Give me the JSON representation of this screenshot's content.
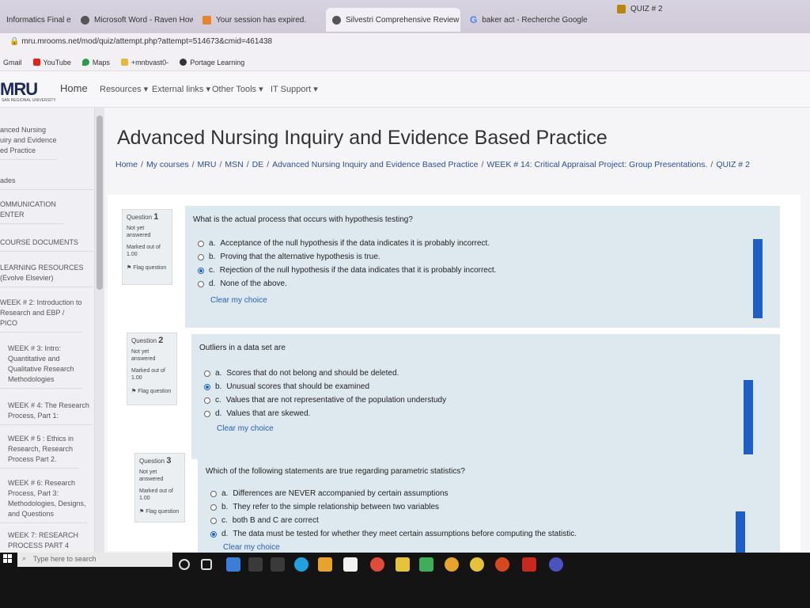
{
  "browser": {
    "tabs": [
      {
        "label": "Informatics Final en",
        "active": false
      },
      {
        "label": "Microsoft Word - Raven Howard",
        "active": false
      },
      {
        "label": "Your session has expired.",
        "active": false
      },
      {
        "label": "Silvestri Comprehensive Review",
        "active": true
      },
      {
        "label": "baker act - Recherche Google",
        "active": false
      },
      {
        "label": "QUIZ # 2",
        "active": false
      }
    ],
    "url": "mru.mrooms.net/mod/quiz/attempt.php?attempt=514673&cmid=461438",
    "bookmarks": [
      "Gmail",
      "YouTube",
      "Maps",
      "+mnbvast0-",
      "Portage Learning"
    ]
  },
  "site_nav": {
    "logo": "MRU",
    "logo_sub": "SAN REGIONAL UNIVERSITY",
    "home": "Home",
    "resources": "Resources ▾",
    "external_links": "External links ▾",
    "other_tools": "Other Tools ▾",
    "it_support": "IT Support ▾"
  },
  "drawer": {
    "course_name": "anced Nursing uiry and Evidence ed Practice",
    "items": [
      {
        "label": "ades"
      },
      {
        "label": "OMMUNICATION ENTER"
      },
      {
        "label": "COURSE DOCUMENTS"
      },
      {
        "label": "LEARNING RESOURCES (Evolve Elsevier)"
      },
      {
        "label": "WEEK # 2: Introduction to Research and EBP / PICO"
      },
      {
        "label": "WEEK # 3: Intro: Quantitative and Qualitative Research Methodologies"
      },
      {
        "label": "WEEK # 4: The Research Process, Part 1:"
      },
      {
        "label": "WEEK # 5 : Ethics in Research, Research Process Part 2."
      },
      {
        "label": "WEEK # 6: Research Process, Part 3: Methodologies, Designs, and Questions"
      },
      {
        "label": "WEEK 7: RESEARCH PROCESS PART 4"
      }
    ]
  },
  "page": {
    "title": "Advanced Nursing Inquiry and Evidence Based Practice",
    "breadcrumb": [
      "Home",
      "My courses",
      "MRU",
      "MSN",
      "DE",
      "Advanced Nursing Inquiry and Evidence Based Practice",
      "WEEK # 14: Critical Appraisal Project: Group Presentations.",
      "QUIZ # 2"
    ]
  },
  "questions": [
    {
      "label": "Question",
      "number": "1",
      "status": "Not yet answered",
      "marked": "Marked out of 1.00",
      "flag": "Flag question",
      "text": "What is the actual process that occurs with hypothesis testing?",
      "options": [
        {
          "letter": "a.",
          "text": "Acceptance of the null hypothesis if the data indicates it is probably incorrect.",
          "selected": false
        },
        {
          "letter": "b.",
          "text": "Proving that the alternative hypothesis is true.",
          "selected": false
        },
        {
          "letter": "c.",
          "text": "Rejection of the null hypothesis if the data indicates that it is probably incorrect.",
          "selected": true
        },
        {
          "letter": "d.",
          "text": "None of the above.",
          "selected": false
        }
      ],
      "clear": "Clear my choice"
    },
    {
      "label": "Question",
      "number": "2",
      "status": "Not yet answered",
      "marked": "Marked out of 1.00",
      "flag": "Flag question",
      "text": "Outliers in a data set are",
      "options": [
        {
          "letter": "a.",
          "text": "Scores that do not belong and should be deleted.",
          "selected": false
        },
        {
          "letter": "b.",
          "text": "Unusual scores that should be examined",
          "selected": true
        },
        {
          "letter": "c.",
          "text": "Values that are not representative of the population understudy",
          "selected": false
        },
        {
          "letter": "d.",
          "text": "Values that are skewed.",
          "selected": false
        }
      ],
      "clear": "Clear my choice"
    },
    {
      "label": "Question",
      "number": "3",
      "status": "Not yet answered",
      "marked": "Marked out of 1.00",
      "flag": "Flag question",
      "text": "Which of the following statements are true regarding parametric statistics?",
      "options": [
        {
          "letter": "a.",
          "text": "Differences are NEVER accompanied by certain assumptions",
          "selected": false
        },
        {
          "letter": "b.",
          "text": "They refer to the simple relationship between two variables",
          "selected": false
        },
        {
          "letter": "c.",
          "text": "both B and C are correct",
          "selected": false
        },
        {
          "letter": "d.",
          "text": "The data must be tested for whether they meet certain assumptions before computing the statistic.",
          "selected": true
        }
      ],
      "clear": "Clear my choice"
    }
  ],
  "taskbar": {
    "search_placeholder": "Type here to search"
  },
  "colors": {
    "accent": "#1d5fc4",
    "link": "#2a4f9a",
    "question_bg": "#dde9ef"
  }
}
